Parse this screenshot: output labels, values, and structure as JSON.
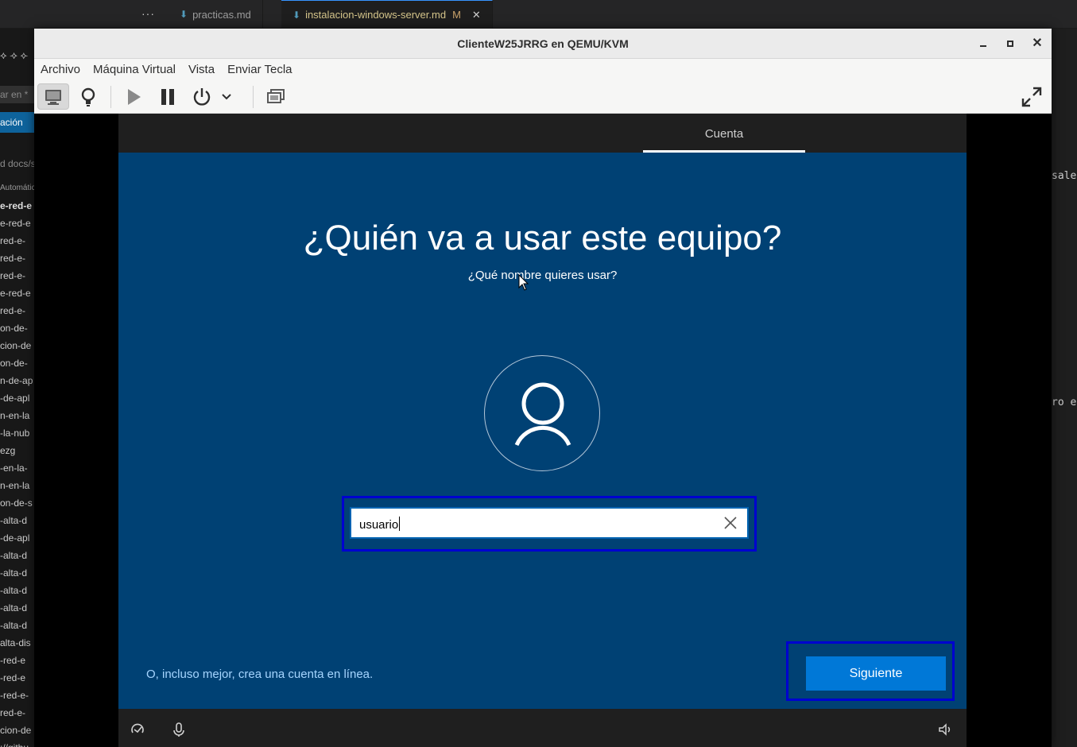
{
  "vscode": {
    "more_label": "···",
    "tabs": [
      {
        "label": "practicas.md",
        "modified": "",
        "active": false
      },
      {
        "label": "instalacion-windows-server.md",
        "modified": "M",
        "active": true
      }
    ],
    "tab_close": "✕",
    "sidebar": {
      "tools": "⟡ ⟢ ⟣",
      "search_placeholder": "ar en *",
      "button_label": "ación",
      "path": "d  docs/s",
      "files": [
        "Automátic",
        "e-red-e",
        "e-red-e",
        "red-e-",
        "red-e-",
        "red-e-",
        "e-red-e",
        "red-e-",
        "on-de-",
        "cion-de",
        "on-de-",
        "n-de-ap",
        "-de-apl",
        "n-en-la",
        "-la-nub",
        "ezg",
        "-en-la-",
        "n-en-la",
        "on-de-s",
        "-alta-d",
        "-de-apl",
        "-alta-d",
        "-alta-d",
        "-alta-d",
        "-alta-d",
        "-alta-d",
        "alta-dis",
        "-red-e",
        "-red-e",
        "-red-e-",
        "red-e-",
        "cion-de",
        "://githu"
      ]
    },
    "editor_fragments": [
      "sale",
      "ro e"
    ]
  },
  "window": {
    "title": "ClienteW25JRRG en QEMU/KVM",
    "controls": [
      "minimize-icon",
      "maximize-icon",
      "close-icon"
    ]
  },
  "menu": {
    "items": [
      "Archivo",
      "Máquina Virtual",
      "Vista",
      "Enviar Tecla"
    ]
  },
  "toolbar": {
    "buttons": [
      "console-icon",
      "details-bulb-icon",
      "run-icon",
      "pause-icon",
      "power-icon",
      "chevron-down-icon",
      "snapshots-icon",
      "fullscreen-icon"
    ]
  },
  "oobe": {
    "header_tab": "Cuenta",
    "headline": "¿Quién va a usar este equipo?",
    "subtitle": "¿Qué nombre quieres usar?",
    "input_value": "usuario",
    "online_link": "O, incluso mejor, crea una cuenta en línea.",
    "next_label": "Siguiente",
    "footer_icons": [
      "ease-of-access-icon",
      "microphone-icon",
      "volume-icon"
    ]
  },
  "colors": {
    "oobe_background": "#004174",
    "oobe_bar": "#1f1f1f",
    "accent_button": "#0078d7",
    "focus_frame": "#0000d0",
    "link": "#a6d5ff"
  }
}
